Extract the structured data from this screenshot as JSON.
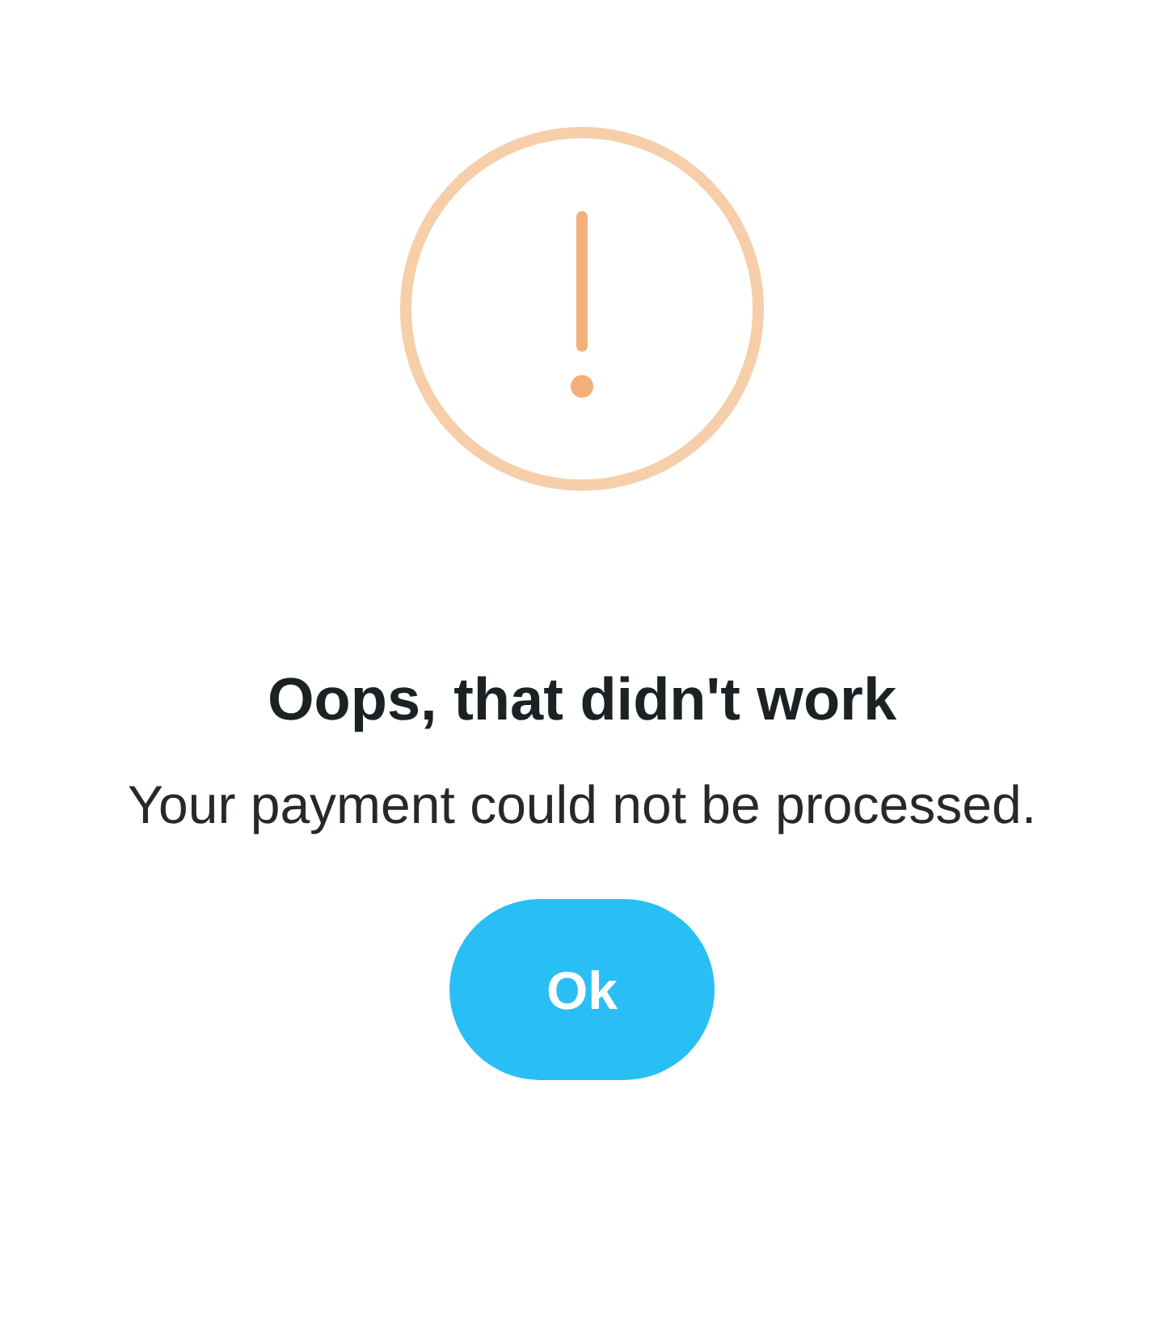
{
  "dialog": {
    "title": "Oops, that didn't work",
    "message": "Your payment could not be processed.",
    "buttons": [
      "Ok"
    ]
  }
}
